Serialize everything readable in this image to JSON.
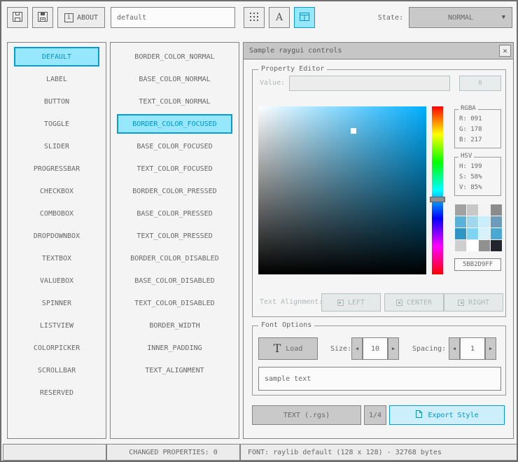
{
  "toolbar": {
    "style_name_value": "default",
    "about_label": "ABOUT",
    "state_label": "State:",
    "state_value": "NORMAL"
  },
  "controls_list": {
    "items": [
      {
        "label": "DEFAULT",
        "selected": true
      },
      {
        "label": "LABEL"
      },
      {
        "label": "BUTTON"
      },
      {
        "label": "TOGGLE"
      },
      {
        "label": "SLIDER"
      },
      {
        "label": "PROGRESSBAR"
      },
      {
        "label": "CHECKBOX"
      },
      {
        "label": "COMBOBOX"
      },
      {
        "label": "DROPDOWNBOX"
      },
      {
        "label": "TEXTBOX"
      },
      {
        "label": "VALUEBOX"
      },
      {
        "label": "SPINNER"
      },
      {
        "label": "LISTVIEW"
      },
      {
        "label": "COLORPICKER"
      },
      {
        "label": "SCROLLBAR"
      },
      {
        "label": "RESERVED"
      }
    ]
  },
  "properties_list": {
    "items": [
      {
        "label": "BORDER_COLOR_NORMAL"
      },
      {
        "label": "BASE_COLOR_NORMAL"
      },
      {
        "label": "TEXT_COLOR_NORMAL"
      },
      {
        "label": "BORDER_COLOR_FOCUSED",
        "selected": true
      },
      {
        "label": "BASE_COLOR_FOCUSED"
      },
      {
        "label": "TEXT_COLOR_FOCUSED"
      },
      {
        "label": "BORDER_COLOR_PRESSED"
      },
      {
        "label": "BASE_COLOR_PRESSED"
      },
      {
        "label": "TEXT_COLOR_PRESSED"
      },
      {
        "label": "BORDER_COLOR_DISABLED"
      },
      {
        "label": "BASE_COLOR_DISABLED"
      },
      {
        "label": "TEXT_COLOR_DISABLED"
      },
      {
        "label": "BORDER_WIDTH"
      },
      {
        "label": "INNER_PADDING"
      },
      {
        "label": "TEXT_ALIGNMENT"
      }
    ]
  },
  "sample_window": {
    "title": "Sample raygui controls",
    "property_editor": {
      "group_label": "Property Editor",
      "value_label": "Value:",
      "value_input": "",
      "value_button": "0",
      "rgba": {
        "label": "RGBA",
        "r": "R: 091",
        "g": "G: 178",
        "b": "B: 217"
      },
      "hsv": {
        "label": "HSV",
        "h": "H: 199",
        "s": "S: 58%",
        "v": "V: 85%"
      },
      "hex_value": "5BB2D9FF",
      "swatches": [
        {
          "color": "#a2a2a2"
        },
        {
          "color": "#c8c8c8"
        },
        {
          "color": "#f3f3f3"
        },
        {
          "color": "#8c8c8c"
        },
        {
          "color": "#5bb2d9"
        },
        {
          "color": "#9fd7ef"
        },
        {
          "color": "#c9effe"
        },
        {
          "color": "#6c9bbc"
        },
        {
          "color": "#2e95c4"
        },
        {
          "color": "#7fd4f2"
        },
        {
          "color": "#d6f2fb"
        },
        {
          "color": "#4aa8d2"
        },
        {
          "color": "#cfcfcf"
        },
        {
          "color": "#ffffff"
        },
        {
          "color": "#909090"
        },
        {
          "color": "#22262c"
        }
      ],
      "text_alignment_label": "Text Alignment:",
      "align_left": "LEFT",
      "align_center": "CENTER",
      "align_right": "RIGHT"
    },
    "font_options": {
      "group_label": "Font Options",
      "load_button": "Load",
      "size_label": "Size:",
      "size_value": "10",
      "spacing_label": "Spacing:",
      "spacing_value": "1",
      "sample_text": "sample text"
    },
    "export_bar": {
      "format_button": "TEXT (.rgs)",
      "page_button": "1/4",
      "export_button": "Export Style"
    }
  },
  "statusbar": {
    "left": "",
    "changed_properties": "CHANGED PROPERTIES: 0",
    "font_info": "FONT: raylib default (128 x 128) - 32768 bytes"
  },
  "icons": {
    "close": "×",
    "dropdown_arrow": "▼",
    "spinner_left": "◀",
    "spinner_right": "▶",
    "font_letter": "A",
    "load_glyph": "T",
    "about_info": "i"
  },
  "colors": {
    "accent_border": "#049cd6",
    "accent_fill": "#97e8ff",
    "accent_text": "#0492c7",
    "selected_hex": "#5bb2d9",
    "hue": 199,
    "saturation_pct": 58,
    "value_pct": 85
  }
}
